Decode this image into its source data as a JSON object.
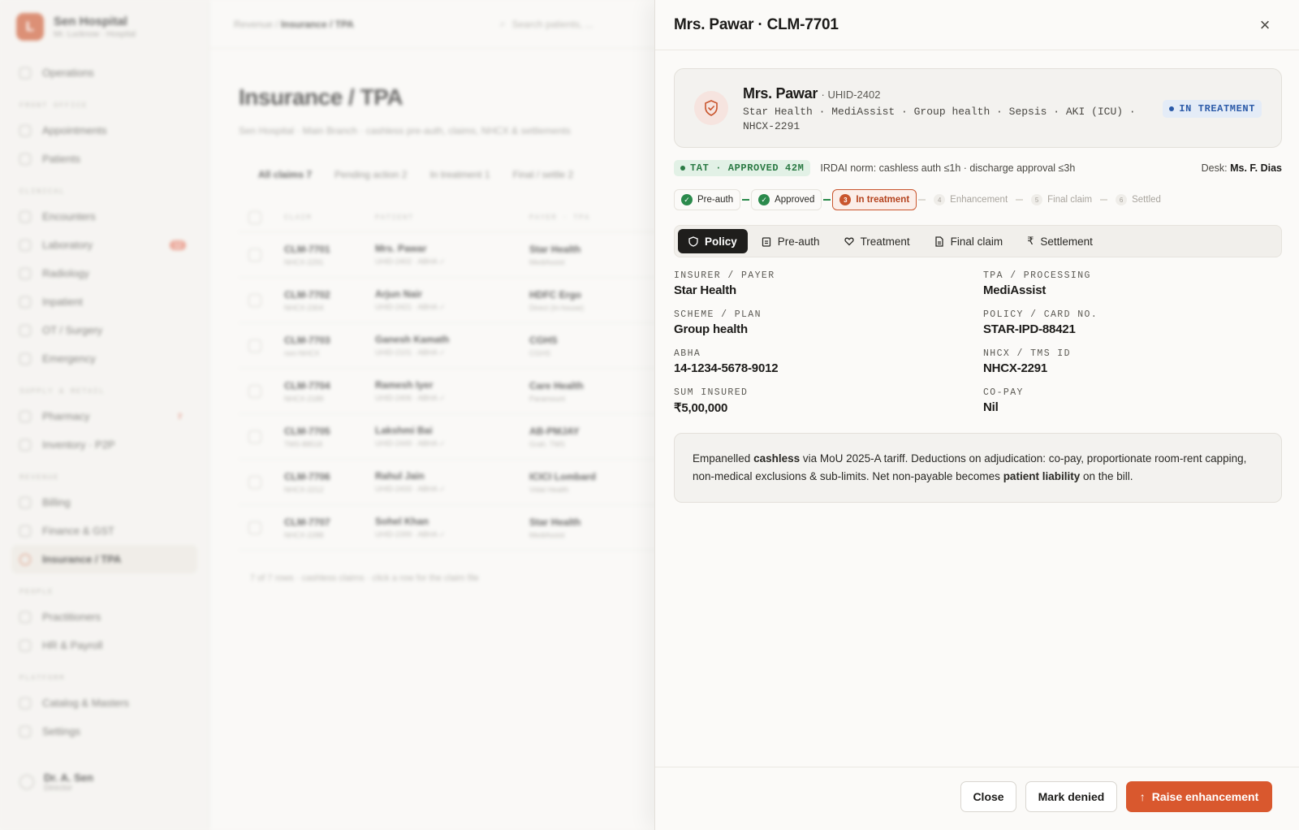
{
  "app": {
    "name": "Sen Hospital",
    "subtitle": "Mr. Lucknow · Hospital",
    "logo_letter": "L"
  },
  "sidebar": {
    "top_item": "Operations",
    "sections": [
      {
        "title": "FRONT OFFICE",
        "items": [
          {
            "label": "Appointments"
          },
          {
            "label": "Patients"
          }
        ]
      },
      {
        "title": "CLINICAL",
        "items": [
          {
            "label": "Encounters"
          },
          {
            "label": "Laboratory",
            "badge": "12"
          },
          {
            "label": "Radiology"
          },
          {
            "label": "Inpatient"
          },
          {
            "label": "OT / Surgery"
          },
          {
            "label": "Emergency"
          }
        ]
      },
      {
        "title": "SUPPLY & RETAIL",
        "items": [
          {
            "label": "Pharmacy",
            "badge": "7"
          },
          {
            "label": "Inventory · P2P"
          }
        ]
      },
      {
        "title": "REVENUE",
        "items": [
          {
            "label": "Billing"
          },
          {
            "label": "Finance & GST"
          },
          {
            "label": "Insurance / TPA",
            "active": true
          }
        ]
      },
      {
        "title": "PEOPLE",
        "items": [
          {
            "label": "Practitioners"
          },
          {
            "label": "HR & Payroll"
          }
        ]
      },
      {
        "title": "PLATFORM",
        "items": [
          {
            "label": "Catalog & Masters"
          },
          {
            "label": "Settings"
          }
        ]
      }
    ],
    "user": {
      "name": "Dr. A. Sen",
      "role": "Director"
    }
  },
  "background": {
    "breadcrumb_parent": "Revenue /",
    "breadcrumb_current": "Insurance / TPA",
    "search_placeholder": "Search patients, ...",
    "page_title": "Insurance / TPA",
    "page_subtitle": "Sen Hospital · Main Branch · cashless pre-auth, claims, NHCX & settlements",
    "filters": [
      "All claims 7",
      "Pending action 2",
      "In treatment 1",
      "Final / settle 2"
    ],
    "table_headers": [
      "CLAIM",
      "PATIENT",
      "PAYER · TPA"
    ],
    "rows": [
      {
        "claim": "CLM-7701",
        "claim_sub": "NHCX-2291",
        "patient": "Mrs. Pawar",
        "patient_sub": "UHID-2402 · ABHA ✓",
        "payer": "Star Health",
        "payer_sub": "MediAssist"
      },
      {
        "claim": "CLM-7702",
        "claim_sub": "NHCX-2304",
        "patient": "Arjun Nair",
        "patient_sub": "UHID-2421 · ABHA ✓",
        "payer": "HDFC Ergo",
        "payer_sub": "Direct (In-house)"
      },
      {
        "claim": "CLM-7703",
        "claim_sub": "non-NHCX",
        "patient": "Ganesh Kamath",
        "patient_sub": "UHID-2101 · ABHA ✓",
        "payer": "CGHS",
        "payer_sub": "CGHS"
      },
      {
        "claim": "CLM-7704",
        "claim_sub": "NHCX-2189",
        "patient": "Ramesh Iyer",
        "patient_sub": "UHID-2406 · ABHA ✓",
        "payer": "Care Health",
        "payer_sub": "Paramount"
      },
      {
        "claim": "CLM-7705",
        "claim_sub": "TMS-88518",
        "patient": "Lakshmi Bai",
        "patient_sub": "UHID-2449 · ABHA ✓",
        "payer": "AB-PMJAY",
        "payer_sub": "Grah. TMS"
      },
      {
        "claim": "CLM-7706",
        "claim_sub": "NHCX-2212",
        "patient": "Rahul Jain",
        "patient_sub": "UHID-2433 · ABHA ✓",
        "payer": "ICICI Lombard",
        "payer_sub": "Vidal Health"
      },
      {
        "claim": "CLM-7707",
        "claim_sub": "NHCX-2288",
        "patient": "Sohel Khan",
        "patient_sub": "UHID-2399 · ABHA ✓",
        "payer": "Star Health",
        "payer_sub": "MediAssist"
      }
    ],
    "footer": "7 of 7 rows · cashless claims · click a row for the claim file"
  },
  "drawer": {
    "title": "Mrs. Pawar · CLM-7701",
    "patient": {
      "name": "Mrs. Pawar",
      "uhid": "· UHID-2402",
      "meta_line1": "Star Health · MediAssist · Group health · Sepsis · AKI (ICU) ·",
      "meta_line2": "NHCX-2291",
      "status": "IN TREATMENT"
    },
    "tat": {
      "pill": "TAT · APPROVED 42M",
      "norm": "IRDAI norm: cashless auth ≤1h · discharge approval ≤3h",
      "desk_label": "Desk:",
      "desk_name": "Ms. F. Dias"
    },
    "steps": [
      {
        "num": "✓",
        "label": "Pre-auth",
        "state": "done"
      },
      {
        "num": "✓",
        "label": "Approved",
        "state": "done"
      },
      {
        "num": "3",
        "label": "In treatment",
        "state": "current"
      },
      {
        "num": "4",
        "label": "Enhancement",
        "state": "pending"
      },
      {
        "num": "5",
        "label": "Final claim",
        "state": "pending"
      },
      {
        "num": "6",
        "label": "Settled",
        "state": "pending"
      }
    ],
    "tabs": [
      {
        "label": "Policy",
        "icon": "shield-icon",
        "active": true
      },
      {
        "label": "Pre-auth",
        "icon": "clipboard-icon"
      },
      {
        "label": "Treatment",
        "icon": "heart-icon"
      },
      {
        "label": "Final claim",
        "icon": "document-icon"
      },
      {
        "label": "Settlement",
        "icon": "rupee-icon"
      }
    ],
    "fields": [
      {
        "label": "INSURER / PAYER",
        "value": "Star Health"
      },
      {
        "label": "TPA / PROCESSING",
        "value": "MediAssist"
      },
      {
        "label": "SCHEME / PLAN",
        "value": "Group health"
      },
      {
        "label": "POLICY / CARD NO.",
        "value": "STAR-IPD-88421"
      },
      {
        "label": "ABHA",
        "value": "14-1234-5678-9012"
      },
      {
        "label": "NHCX / TMS ID",
        "value": "NHCX-2291"
      },
      {
        "label": "SUM INSURED",
        "value": "₹5,00,000"
      },
      {
        "label": "CO-PAY",
        "value": "Nil"
      }
    ],
    "note": {
      "p1": "Empanelled ",
      "b1": "cashless",
      "p2": " via MoU 2025-A tariff. Deductions on adjudication: co-pay, proportionate room-rent capping, non-medical exclusions & sub-limits. Net non-payable becomes ",
      "b2": "patient liability",
      "p3": " on the bill."
    },
    "buttons": {
      "close": "Close",
      "deny": "Mark denied",
      "raise": "Raise enhancement"
    }
  },
  "colors": {
    "accent": "#d9582e",
    "success": "#2b8a4c",
    "info": "#2b5aa8"
  }
}
